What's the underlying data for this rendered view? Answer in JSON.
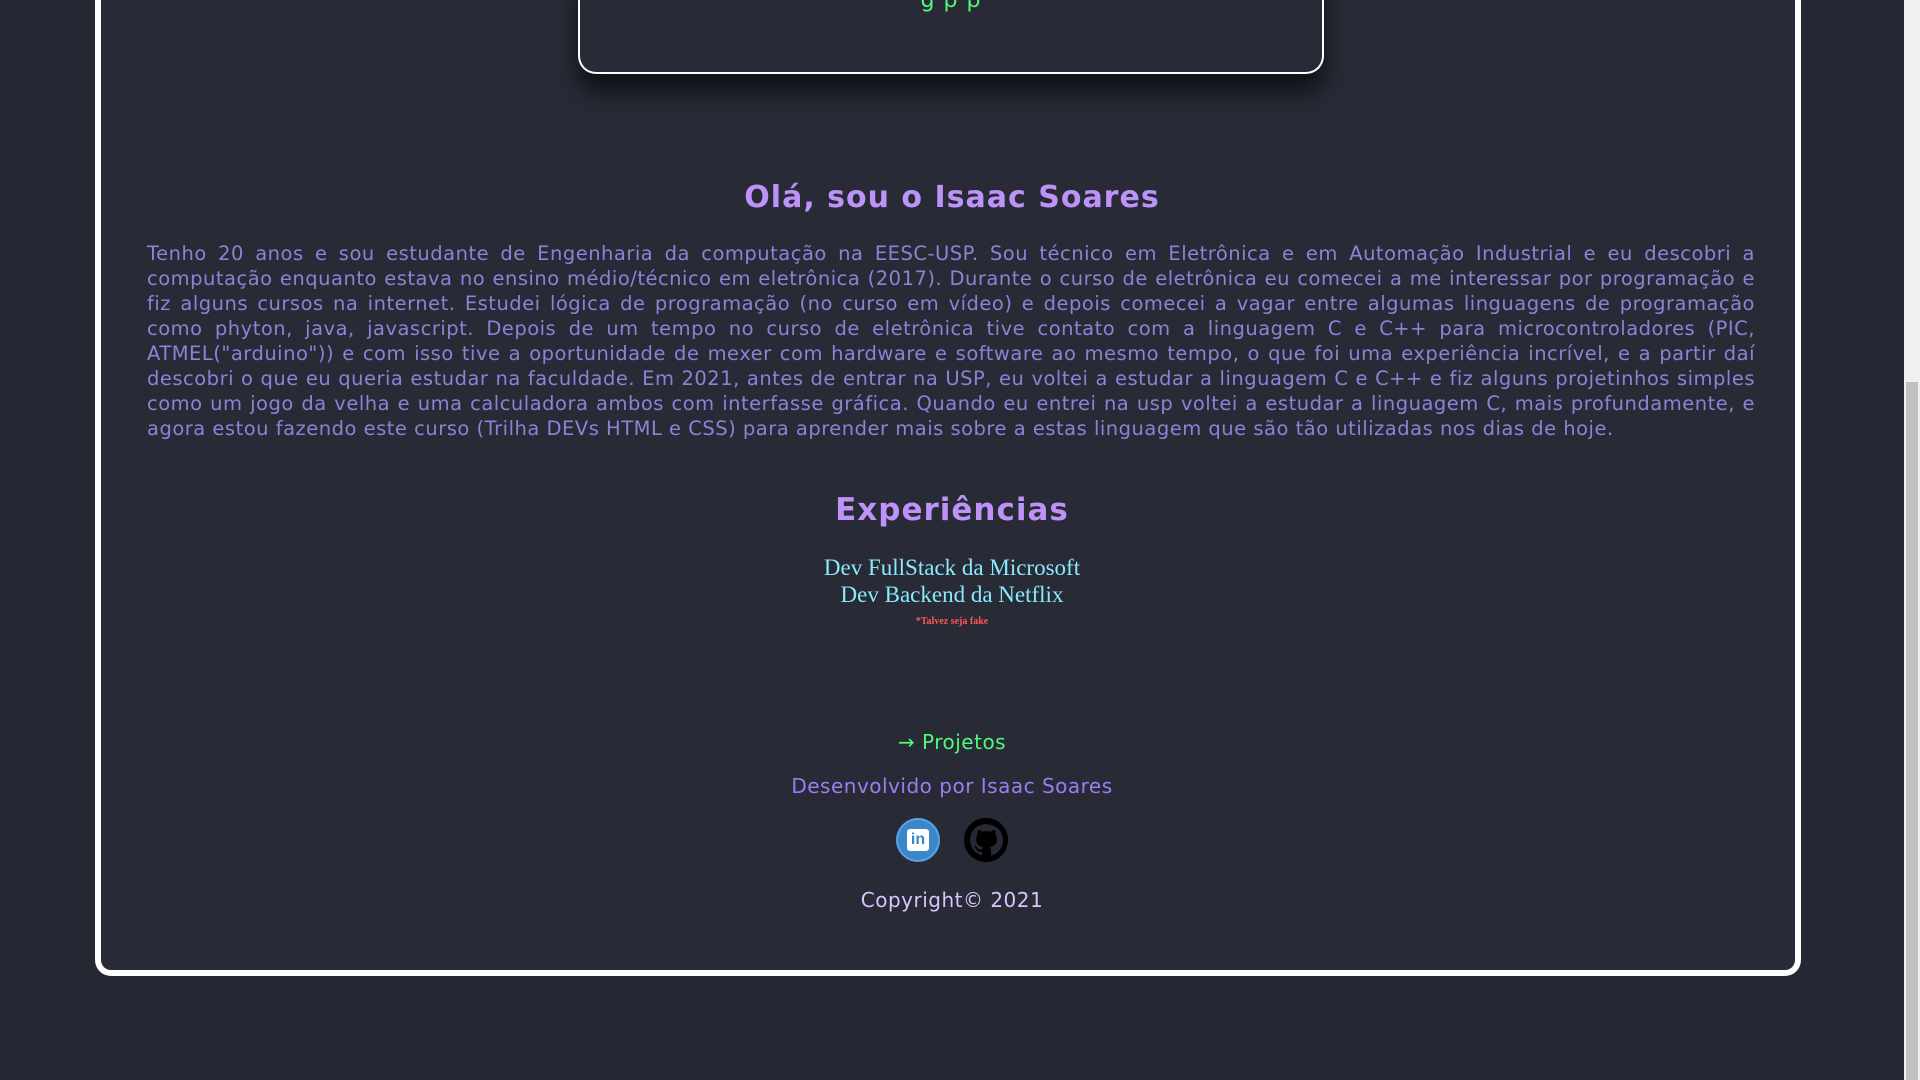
{
  "top_box": {
    "text": "g                    p      p"
  },
  "intro": {
    "title": "Olá, sou o Isaac Soares",
    "bio": "Tenho 20 anos e sou estudante de Engenharia da computação na EESC-USP. Sou técnico em Eletrônica e em Automação Industrial e eu descobri a computação enquanto estava no ensino médio/técnico em eletrônica (2017). Durante o curso de eletrônica eu comecei a me interessar por programação e fiz alguns cursos na internet. Estudei lógica de programação (no curso em vídeo) e depois comecei a vagar entre algumas linguagens de programação como phyton, java, javascript. Depois de um tempo no curso de eletrônica tive contato com a linguagem C e C++ para microcontroladores (PIC, ATMEL(\"arduino\")) e com isso tive a oportunidade de mexer com hardware e software ao mesmo tempo, o que foi uma experiência incrível, e a partir daí descobri o que eu queria estudar na faculdade. Em 2021, antes de entrar na USP, eu voltei a estudar a linguagem C e C++ e fiz alguns projetinhos simples como um jogo da velha e uma calculadora ambos com interfasse gráfica. Quando eu entrei na usp voltei a estudar a linguagem C, mais profundamente, e agora estou fazendo este curso (Trilha DEVs HTML e CSS) para aprender mais sobre a estas linguagem que são tão utilizadas nos dias de hoje."
  },
  "experiences": {
    "title": "Experiências",
    "items": [
      "Dev FullStack da Microsoft",
      "Dev Backend da Netflix"
    ],
    "note": "*Talvez seja fake"
  },
  "footer": {
    "projects_link": "→ Projetos",
    "developed_by": "Desenvolvido por Isaac Soares",
    "copyright": "Copyright© 2021",
    "social": {
      "linkedin_label": "in"
    }
  },
  "colors": {
    "background": "#262834",
    "card": "#282a36",
    "heading": "#bd93f9",
    "bio_text": "#8c82d6",
    "experience_text": "#8be9fd",
    "note": "#ff5555",
    "link": "#50fa7b"
  }
}
